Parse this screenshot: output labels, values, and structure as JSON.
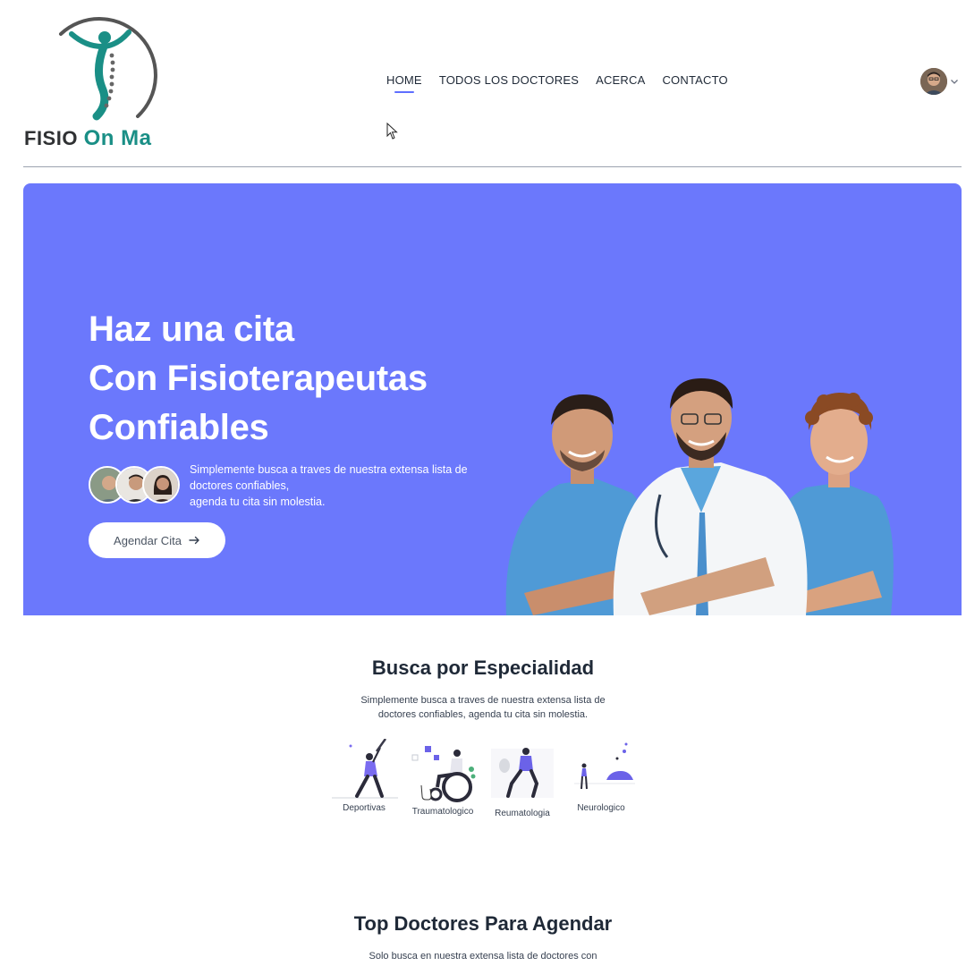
{
  "brand": {
    "word1": "FISIO",
    "word2": "On Ma",
    "primary_color": "#1a8f86",
    "ring_color": "#555555"
  },
  "nav": {
    "items": [
      {
        "label": "HOME",
        "active": true
      },
      {
        "label": "TODOS LOS DOCTORES",
        "active": false
      },
      {
        "label": "ACERCA",
        "active": false
      },
      {
        "label": "CONTACTO",
        "active": false
      }
    ],
    "accent_color": "#5f6fff"
  },
  "profile": {
    "avatar_icon": "user-avatar",
    "dropdown_icon": "chevron-down-icon"
  },
  "hero": {
    "background": "#6b78fc",
    "title_lines": [
      "Haz una cita",
      "Con Fisioterapeutas",
      "Confiables"
    ],
    "description_lines": [
      "Simplemente busca a traves de nuestra extensa lista de",
      "doctores confiables,",
      "agenda tu cita sin molestia."
    ],
    "cta_label": "Agendar Cita",
    "cta_icon": "arrow-right-icon"
  },
  "specialties": {
    "title": "Busca por Especialidad",
    "subtitle_lines": [
      "Simplemente busca a traves de nuestra extensa lista de",
      "doctores confiables, agenda tu cita sin molestia."
    ],
    "items": [
      {
        "label": "Deportivas",
        "icon": "sports-illustration"
      },
      {
        "label": "Traumatologico",
        "icon": "wheelchair-illustration"
      },
      {
        "label": "Reumatologia",
        "icon": "rheumatology-illustration"
      },
      {
        "label": "Neurologico",
        "icon": "neurology-illustration"
      }
    ]
  },
  "top_doctors": {
    "title": "Top Doctores Para Agendar",
    "subtitle": "Solo busca en nuestra extensa lista de doctores con"
  }
}
